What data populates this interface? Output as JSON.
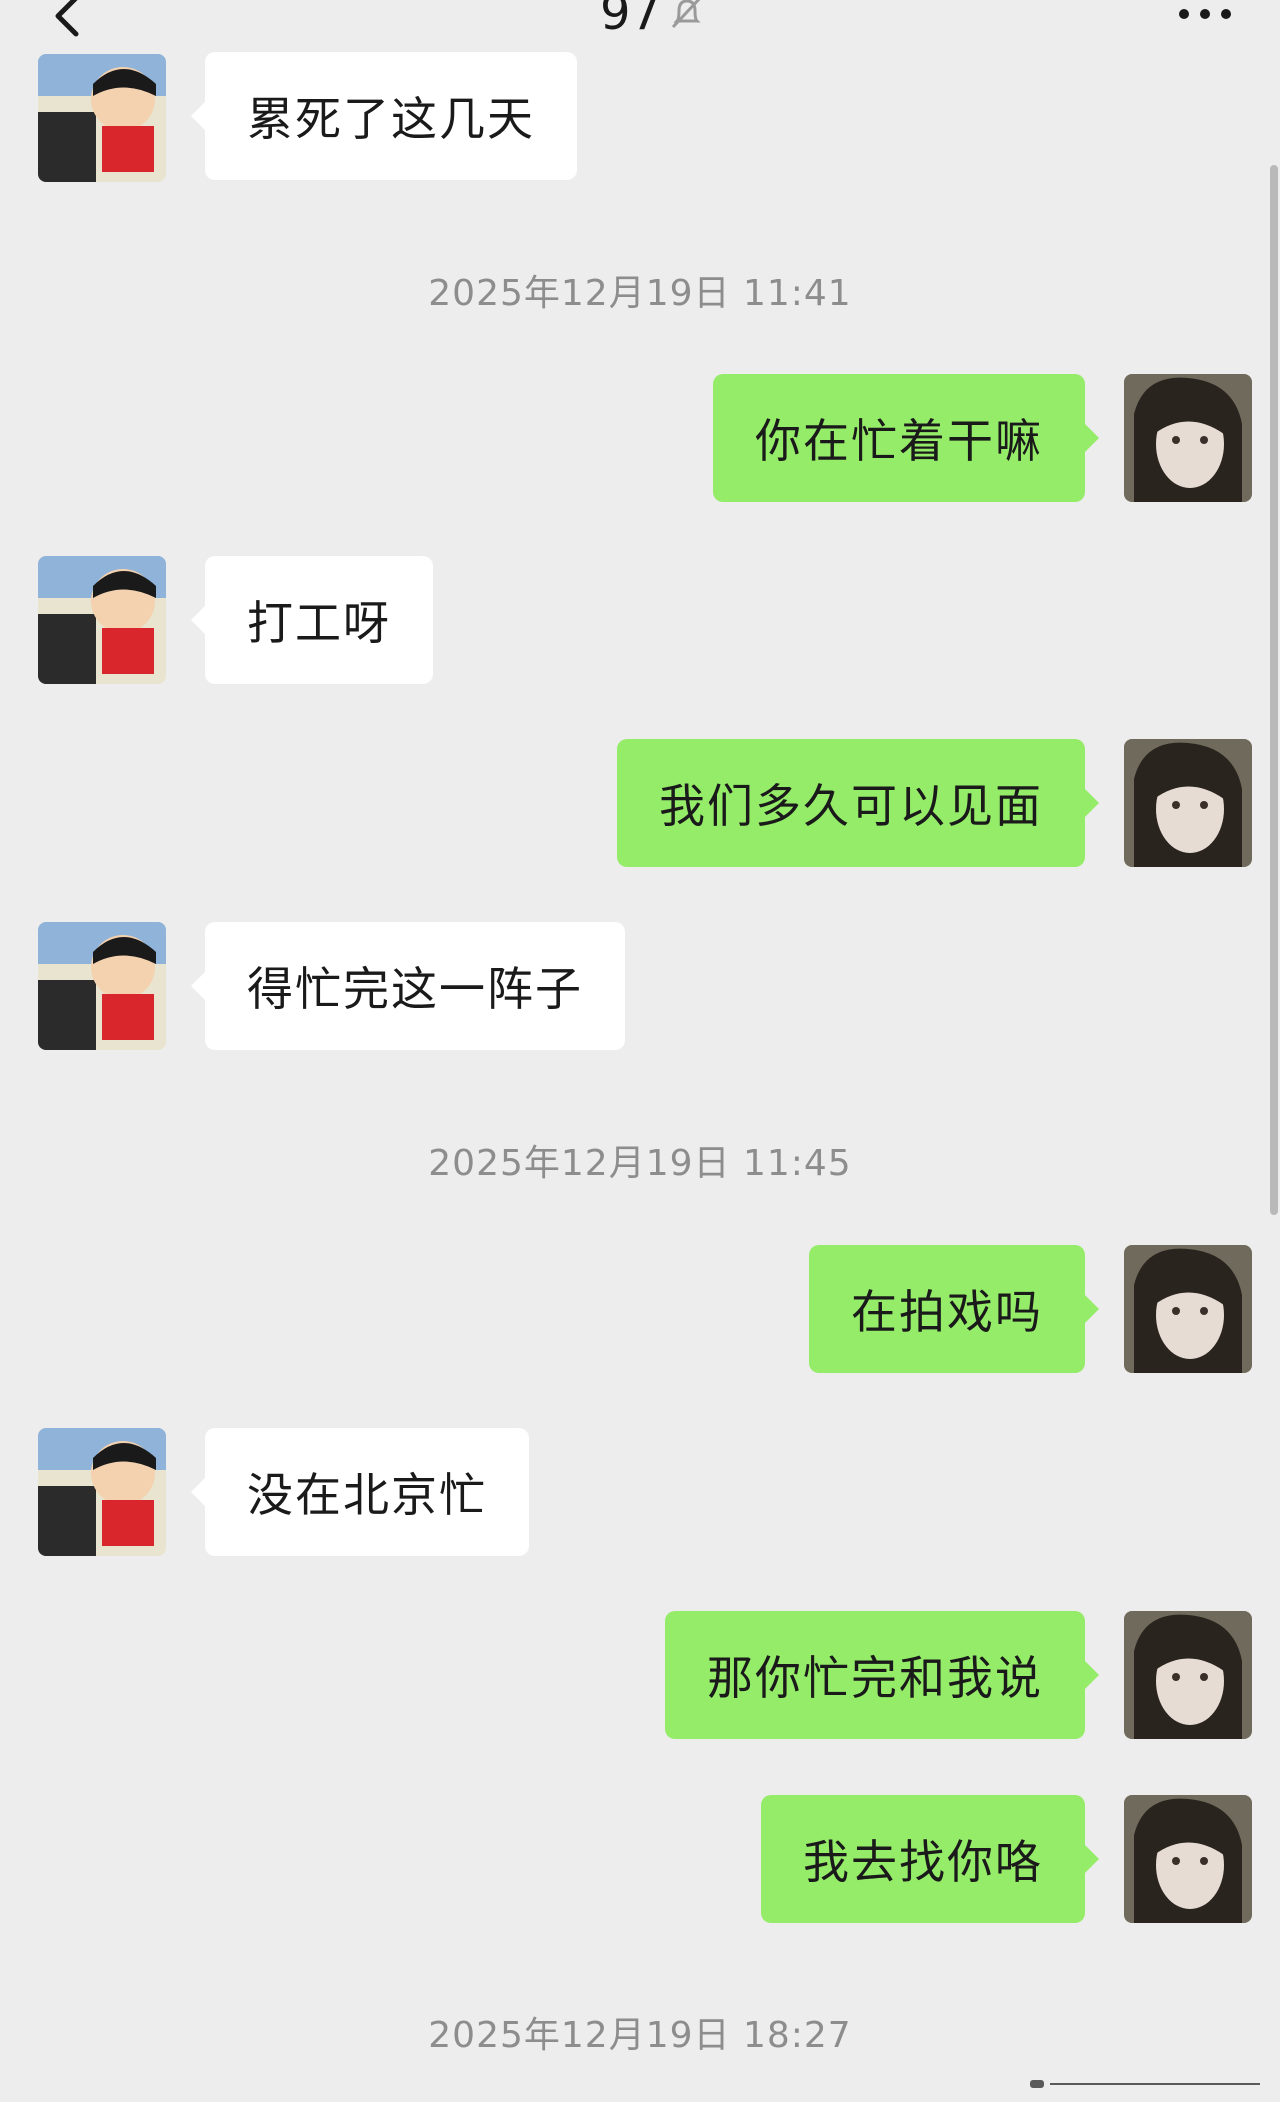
{
  "header": {
    "title": "97",
    "muted_icon": "bell-off-icon",
    "back_icon": "chevron-left-icon",
    "more_icon": "more-dots-icon"
  },
  "colors": {
    "background": "#ededed",
    "sent_bubble": "#95ec69",
    "received_bubble": "#ffffff",
    "timestamp_text": "#8d8d8d"
  },
  "timestamps": [
    "2025年12月19日 11:41",
    "2025年12月19日 11:45",
    "2025年12月19日 18:27"
  ],
  "messages": [
    {
      "sender": "other",
      "text": "累死了这几天"
    },
    {
      "sender": "me",
      "text": "你在忙着干嘛"
    },
    {
      "sender": "other",
      "text": "打工呀"
    },
    {
      "sender": "me",
      "text": "我们多久可以见面"
    },
    {
      "sender": "other",
      "text": "得忙完这一阵子"
    },
    {
      "sender": "me",
      "text": "在拍戏吗"
    },
    {
      "sender": "other",
      "text": "没在北京忙"
    },
    {
      "sender": "me",
      "text": "那你忙完和我说"
    },
    {
      "sender": "me",
      "text": "我去找你咯"
    }
  ]
}
